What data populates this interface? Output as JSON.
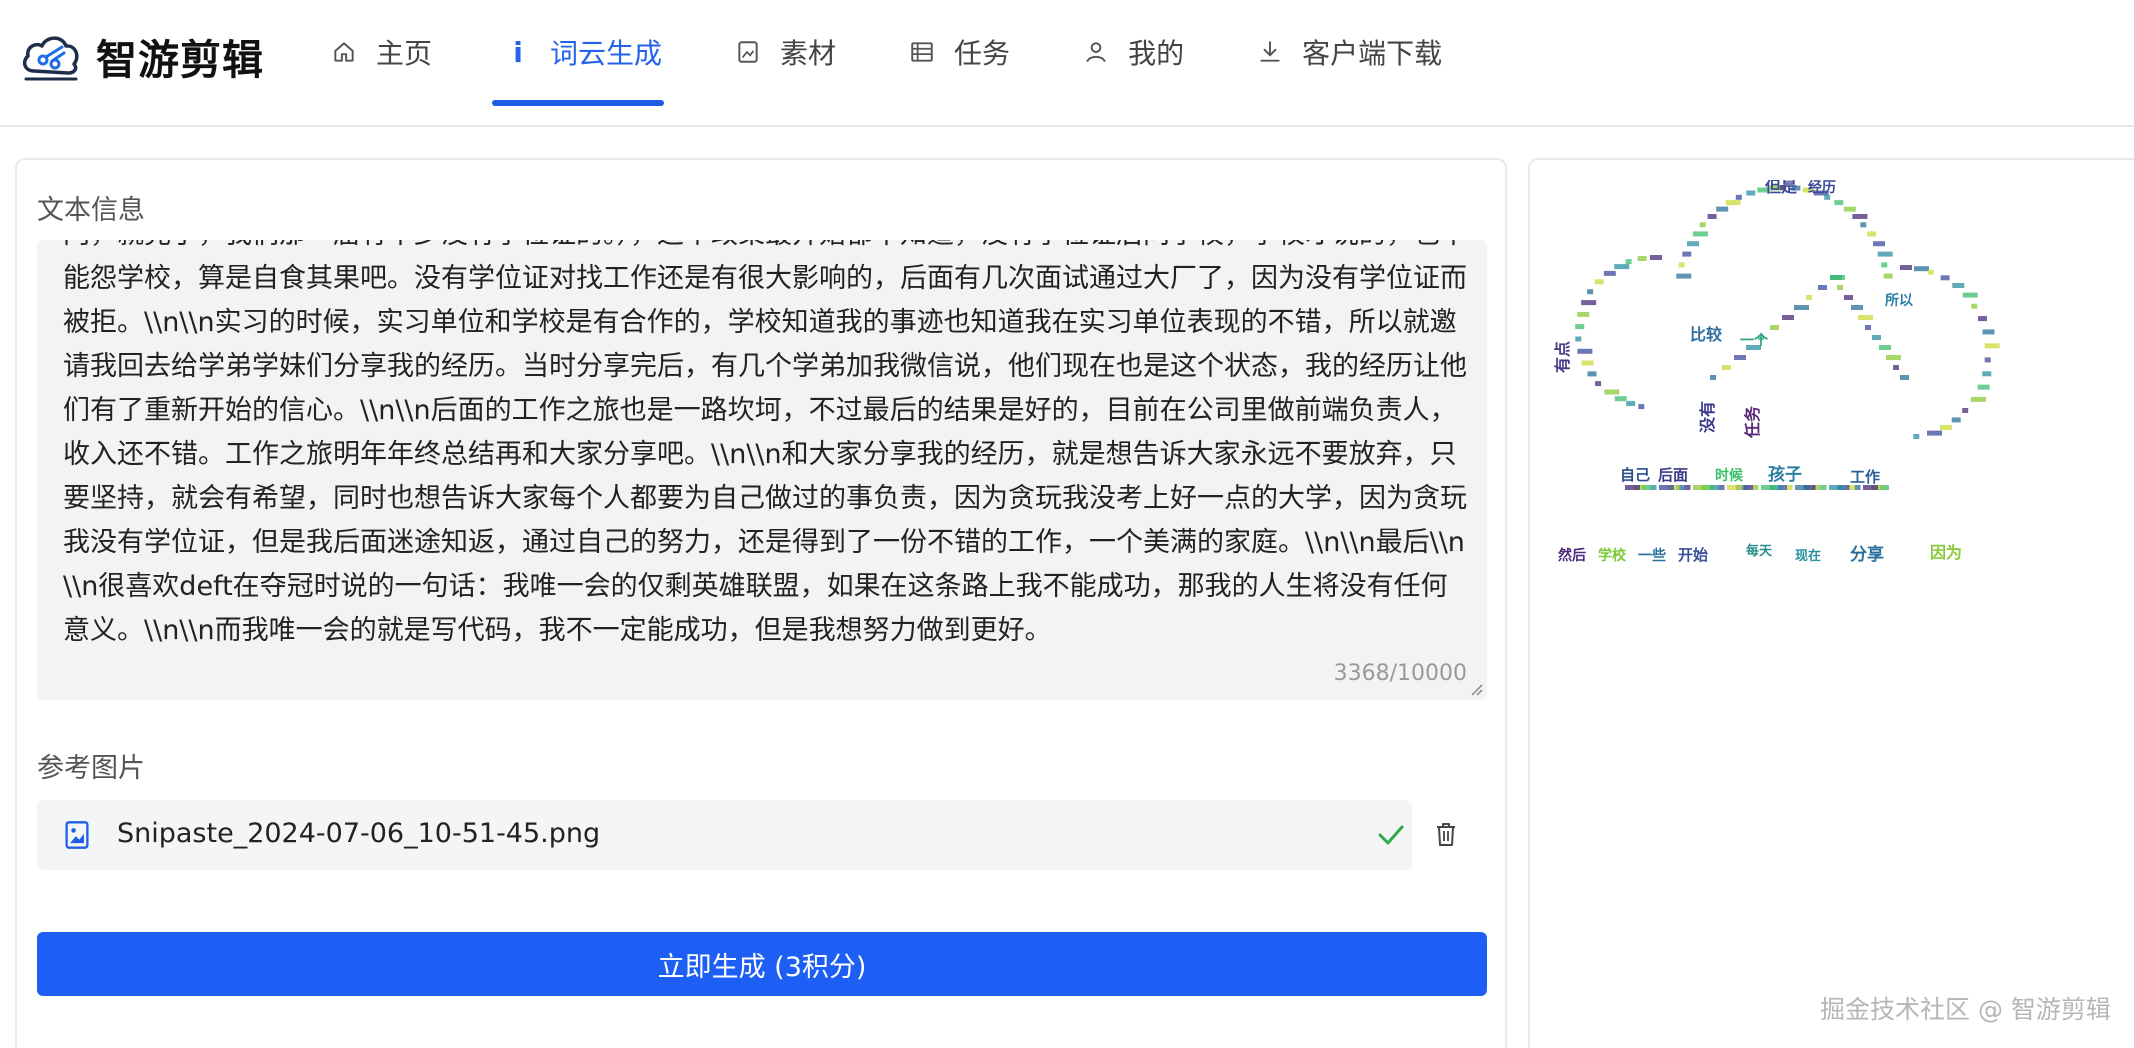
{
  "app": {
    "name": "智游剪辑"
  },
  "nav": {
    "items": [
      {
        "label": "主页",
        "icon": "home-icon"
      },
      {
        "label": "词云生成",
        "icon": "info-icon",
        "active": true
      },
      {
        "label": "素材",
        "icon": "image-icon"
      },
      {
        "label": "任务",
        "icon": "task-list-icon"
      },
      {
        "label": "我的",
        "icon": "user-icon"
      },
      {
        "label": "客户端下载",
        "icon": "download-icon"
      }
    ]
  },
  "form": {
    "text_label": "文本信息",
    "text_value": "门，就完了，我们那一届有不少没有学位证的。），这个政策最开始都不知道，没有学位证后问学校，学校才说的，也不能怨学校，算是自食其果吧。没有学位证对找工作还是有很大影响的，后面有几次面试通过大厂了，因为没有学位证而被拒。\\\\n\\\\n实习的时候，实习单位和学校是有合作的，学校知道我的事迹也知道我在实习单位表现的不错，所以就邀请我回去给学弟学妹们分享我的经历。当时分享完后，有几个学弟加我微信说，他们现在也是这个状态，我的经历让他们有了重新开始的信心。\\\\n\\\\n后面的工作之旅也是一路坎坷，不过最后的结果是好的，目前在公司里做前端负责人，收入还不错。工作之旅明年年终总结再和大家分享吧。\\\\n\\\\n和大家分享我的经历，就是想告诉大家永远不要放弃，只要坚持，就会有希望，同时也想告诉大家每个人都要为自己做过的事负责，因为贪玩我没考上好一点的大学，因为贪玩我没有学位证，但是我后面迷途知返，通过自己的努力，还是得到了一份不错的工作，一个美满的家庭。\\\\n\\\\n最后\\\\n\\\\n很喜欢deft在夺冠时说的一句话：我唯一会的仅剩英雄联盟，如果在这条路上我不能成功，那我的人生将没有任何意义。\\\\n\\\\n而我唯一会的就是写代码，我不一定能成功，但是我想努力做到更好。",
    "char_count": "3368/10000",
    "image_label": "参考图片",
    "file_name": "Snipaste_2024-07-06_10-51-45.png",
    "generate_label": "立即生成 (3积分)"
  },
  "wordcloud": {
    "words": [
      {
        "text": "但是",
        "color": "#3b4a9a"
      },
      {
        "text": "经历",
        "color": "#3b4a9a"
      },
      {
        "text": "比较",
        "color": "#2f6fa0"
      },
      {
        "text": "一个",
        "color": "#2aa08a"
      },
      {
        "text": "所以",
        "color": "#2f7fa8"
      },
      {
        "text": "有点",
        "color": "#4a3b8a"
      },
      {
        "text": "没有",
        "color": "#3a3a8a"
      },
      {
        "text": "任务",
        "color": "#5a2a7a"
      },
      {
        "text": "自己",
        "color": "#2a4f8a"
      },
      {
        "text": "后面",
        "color": "#3a3a8a"
      },
      {
        "text": "时候",
        "color": "#3bbf6a"
      },
      {
        "text": "孩子",
        "color": "#2a7fa0"
      },
      {
        "text": "工作",
        "color": "#2a5f9a"
      },
      {
        "text": "然后",
        "color": "#4a2a7a"
      },
      {
        "text": "学校",
        "color": "#7ac93a"
      },
      {
        "text": "一些",
        "color": "#2a6f9a"
      },
      {
        "text": "开始",
        "color": "#3a4f9a"
      },
      {
        "text": "每天",
        "color": "#2a8f8a"
      },
      {
        "text": "现在",
        "color": "#2a8fa0"
      },
      {
        "text": "分享",
        "color": "#2a6f9a"
      },
      {
        "text": "因为",
        "color": "#8ac93a"
      }
    ]
  },
  "watermark": "掘金技术社区 @ 智游剪辑"
}
